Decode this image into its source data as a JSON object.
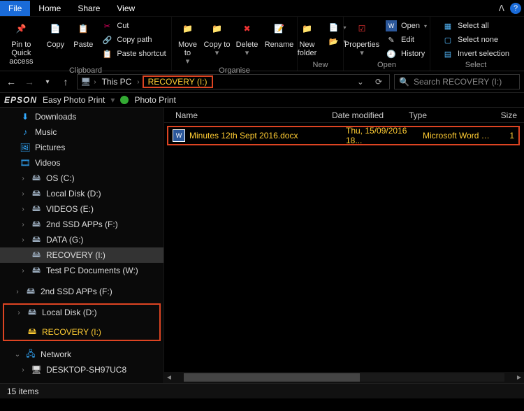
{
  "tabs": {
    "file": "File",
    "home": "Home",
    "share": "Share",
    "view": "View"
  },
  "ribbon": {
    "clipboard": {
      "label": "Clipboard",
      "pin": "Pin to Quick access",
      "copy": "Copy",
      "paste": "Paste",
      "cut": "Cut",
      "copy_path": "Copy path",
      "paste_shortcut": "Paste shortcut"
    },
    "organise": {
      "label": "Organise",
      "move_to": "Move to",
      "copy_to": "Copy to",
      "delete": "Delete",
      "rename": "Rename"
    },
    "new": {
      "label": "New",
      "new_folder": "New folder"
    },
    "open": {
      "label": "Open",
      "properties": "Properties",
      "open": "Open",
      "edit": "Edit",
      "history": "History"
    },
    "select": {
      "label": "Select",
      "select_all": "Select all",
      "select_none": "Select none",
      "invert": "Invert selection"
    }
  },
  "breadcrumbs": {
    "this_pc": "This PC",
    "recovery": "RECOVERY (I:)"
  },
  "search": {
    "placeholder": "Search RECOVERY (I:)"
  },
  "epson": {
    "brand": "EPSON",
    "easy": "Easy Photo Print",
    "photo": "Photo Print"
  },
  "tree": {
    "downloads": "Downloads",
    "music": "Music",
    "pictures": "Pictures",
    "videos": "Videos",
    "os_c": "OS (C:)",
    "local_d": "Local Disk (D:)",
    "videos_e": "VIDEOS (E:)",
    "ssd_f": "2nd SSD APPs (F:)",
    "data_g": "DATA (G:)",
    "recovery_i": "RECOVERY (I:)",
    "test_w": "Test PC Documents (W:)",
    "ssd_f2": "2nd SSD APPs (F:)",
    "local_d2": "Local Disk (D:)",
    "recovery_i2": "RECOVERY (I:)",
    "network": "Network",
    "desktop_pc": "DESKTOP-SH97UC8"
  },
  "columns": {
    "name": "Name",
    "date": "Date modified",
    "type": "Type",
    "size": "Size"
  },
  "file": {
    "name": "Minutes 12th Sept 2016.docx",
    "date": "Thu, 15/09/2016 18...",
    "type": "Microsoft Word D...",
    "size": "1"
  },
  "status": {
    "items": "15 items"
  }
}
